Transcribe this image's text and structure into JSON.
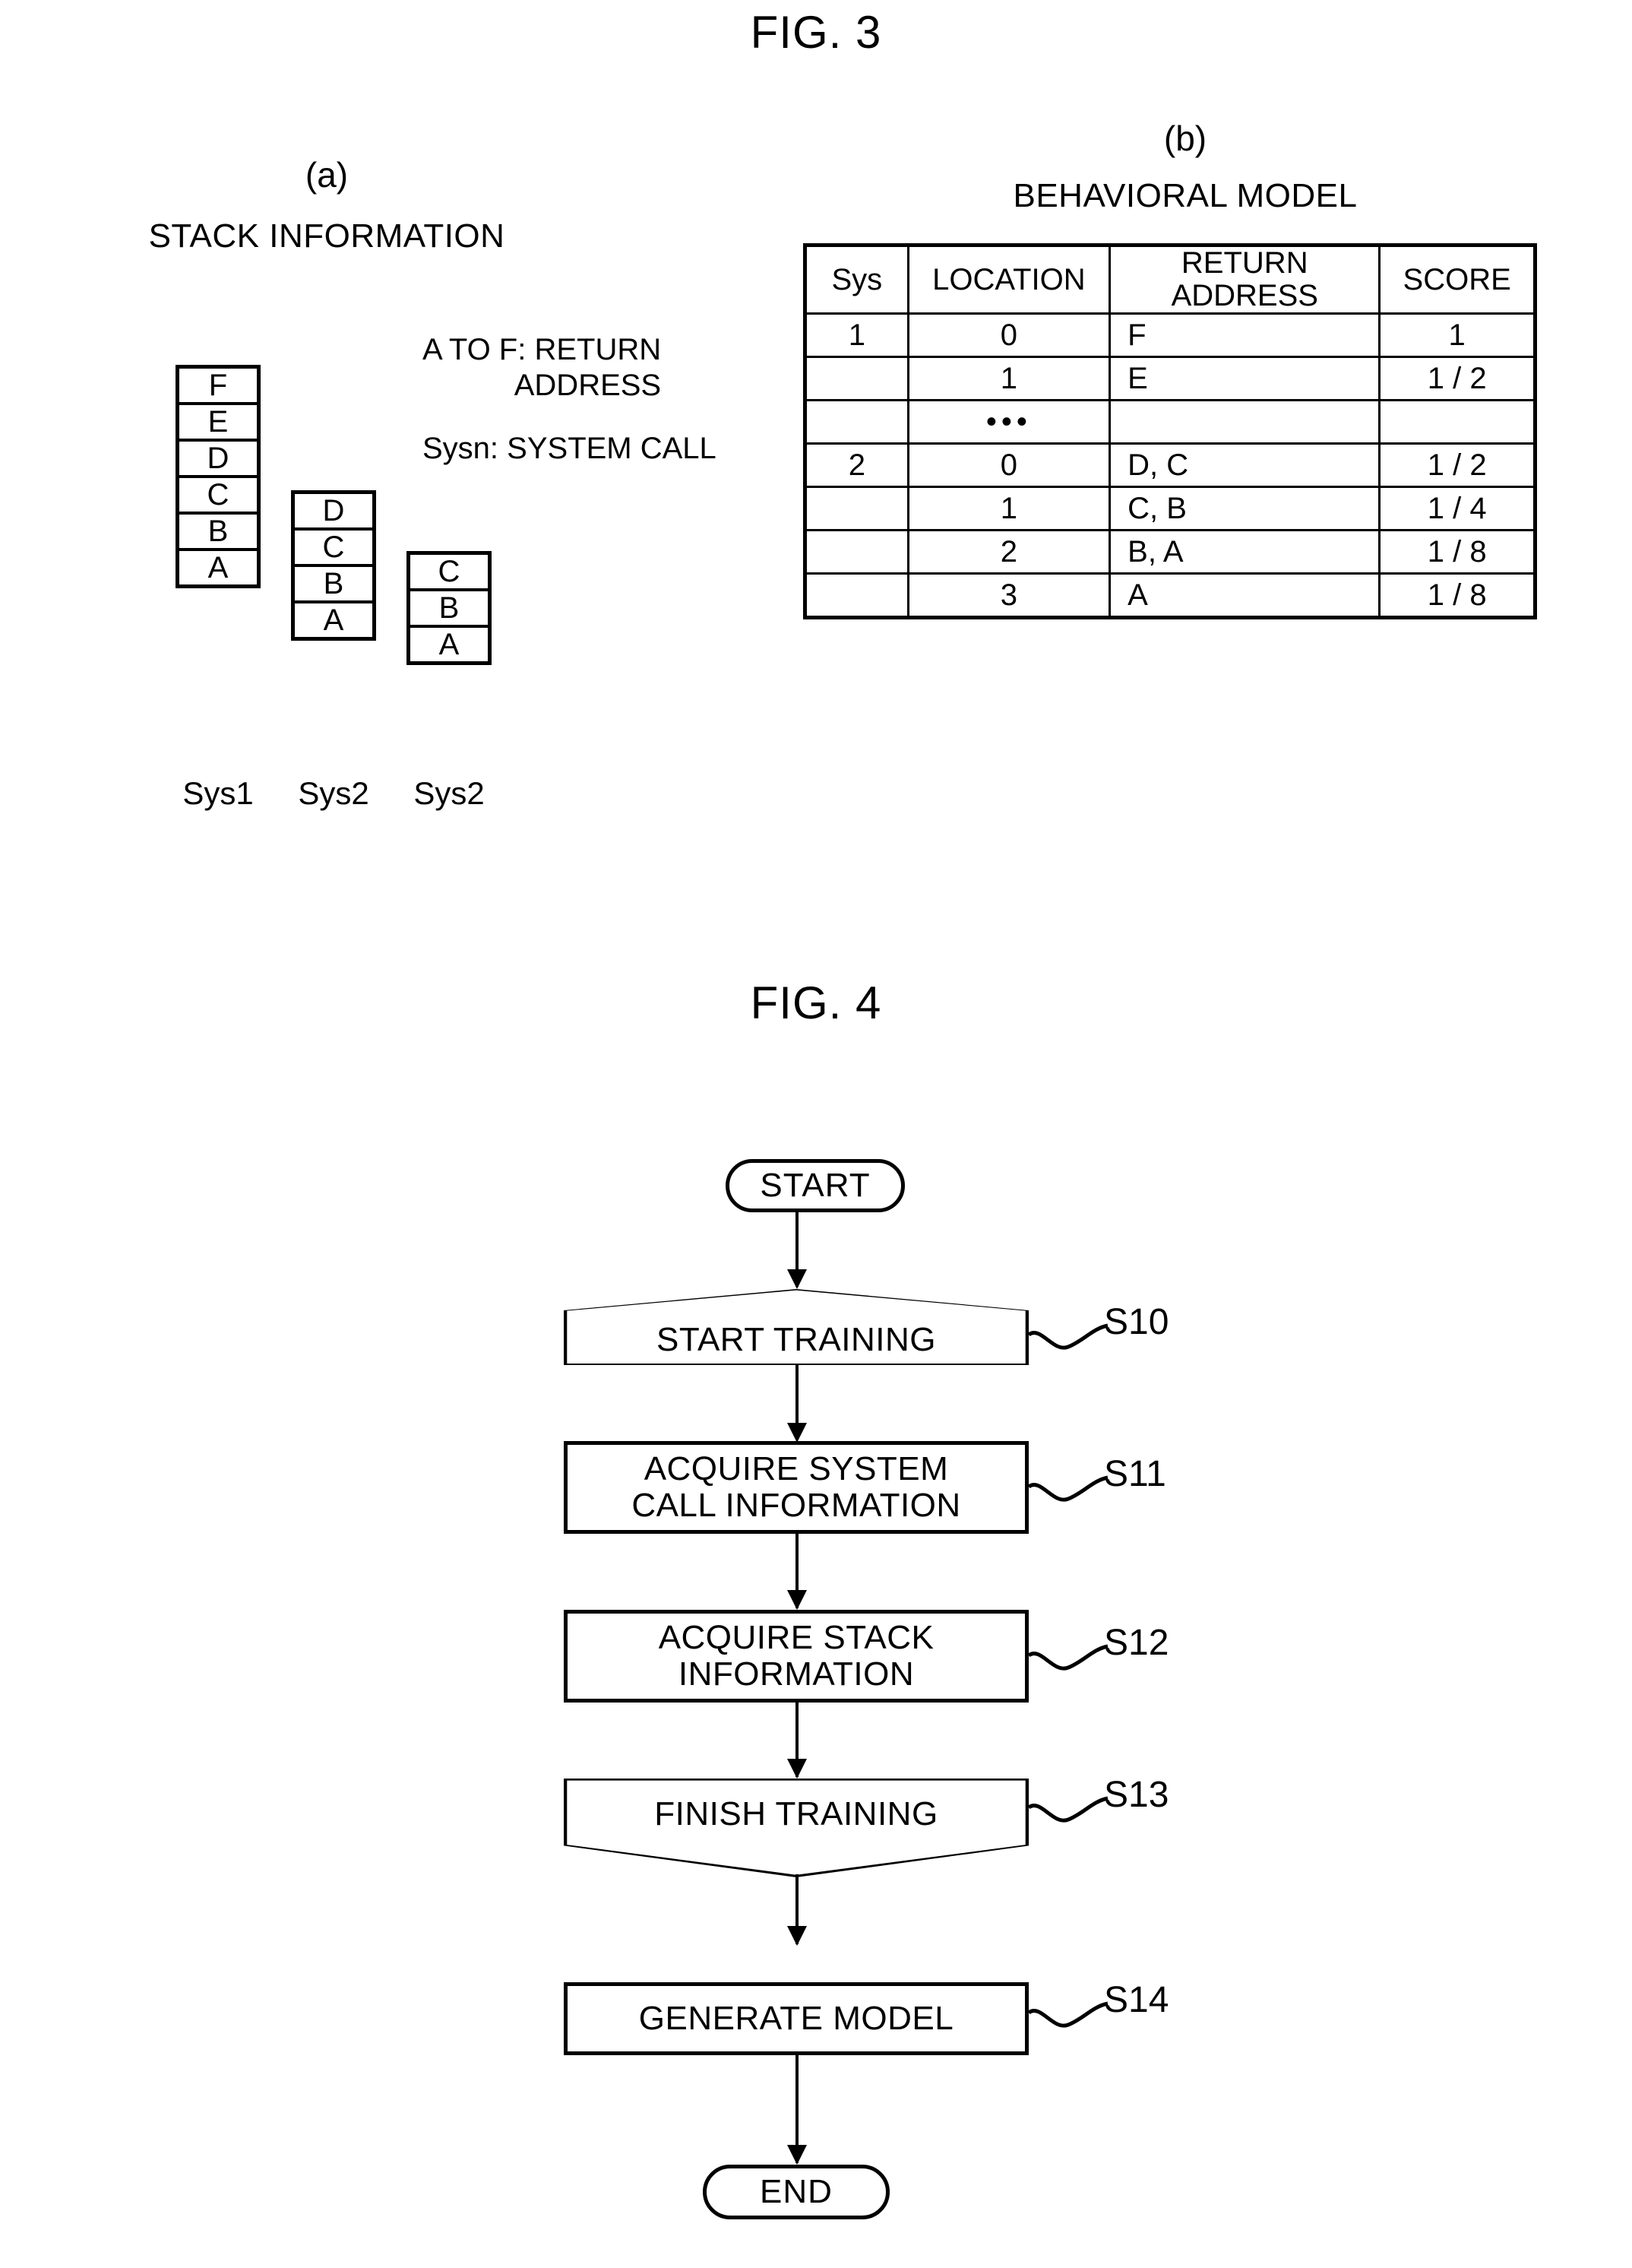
{
  "figures": [
    {
      "id": "fig3",
      "title": "FIG. 3"
    },
    {
      "id": "fig4",
      "title": "FIG. 4"
    }
  ],
  "fig3": {
    "title": "FIG. 3",
    "part_a": {
      "letter": "(a)",
      "caption": "STACK INFORMATION",
      "legend": {
        "line1": "A TO F: RETURN",
        "line2": "ADDRESS",
        "line3": "Sysn: SYSTEM CALL"
      },
      "stacks": [
        {
          "label": "Sys1",
          "cells": [
            "F",
            "E",
            "D",
            "C",
            "B",
            "A"
          ]
        },
        {
          "label": "Sys2",
          "cells": [
            "D",
            "C",
            "B",
            "A"
          ]
        },
        {
          "label": "Sys2",
          "cells": [
            "C",
            "B",
            "A"
          ]
        }
      ]
    },
    "part_b": {
      "letter": "(b)",
      "caption": "BEHAVIORAL MODEL",
      "table": {
        "headers": [
          "Sys",
          "LOCATION",
          "RETURN ADDRESS",
          "SCORE"
        ],
        "header_return_address_line1": "RETURN",
        "header_return_address_line2": "ADDRESS",
        "rows": [
          {
            "sys": "1",
            "location": "0",
            "return_address": "F",
            "score": "1"
          },
          {
            "sys": "",
            "location": "1",
            "return_address": "E",
            "score": "1 / 2"
          },
          {
            "sys": "",
            "location": "•••",
            "return_address": "",
            "score": ""
          },
          {
            "sys": "2",
            "location": "0",
            "return_address": "D, C",
            "score": "1 / 2"
          },
          {
            "sys": "",
            "location": "1",
            "return_address": "C, B",
            "score": "1 / 4"
          },
          {
            "sys": "",
            "location": "2",
            "return_address": "B, A",
            "score": "1 / 8"
          },
          {
            "sys": "",
            "location": "3",
            "return_address": "A",
            "score": "1 / 8"
          }
        ]
      }
    }
  },
  "fig4": {
    "title": "FIG. 4",
    "start_terminal": "START",
    "end_terminal": "END",
    "steps": [
      {
        "id": "S10",
        "shape": "pentagon-up",
        "label_line1": "START  TRAINING",
        "label_line2": "",
        "step": "S10"
      },
      {
        "id": "S11",
        "shape": "rect",
        "label_line1": "ACQUIRE  SYSTEM",
        "label_line2": "CALL INFORMATION",
        "step": "S11"
      },
      {
        "id": "S12",
        "shape": "rect",
        "label_line1": "ACQUIRE  STACK",
        "label_line2": "INFORMATION",
        "step": "S12"
      },
      {
        "id": "S13",
        "shape": "pentagon-down",
        "label_line1": "FINISH  TRAINING",
        "label_line2": "",
        "step": "S13"
      },
      {
        "id": "S14",
        "shape": "rect",
        "label_line1": "GENERATE  MODEL",
        "label_line2": "",
        "step": "S14"
      }
    ]
  },
  "colors": {
    "ink": "#000000",
    "paper": "#ffffff"
  }
}
